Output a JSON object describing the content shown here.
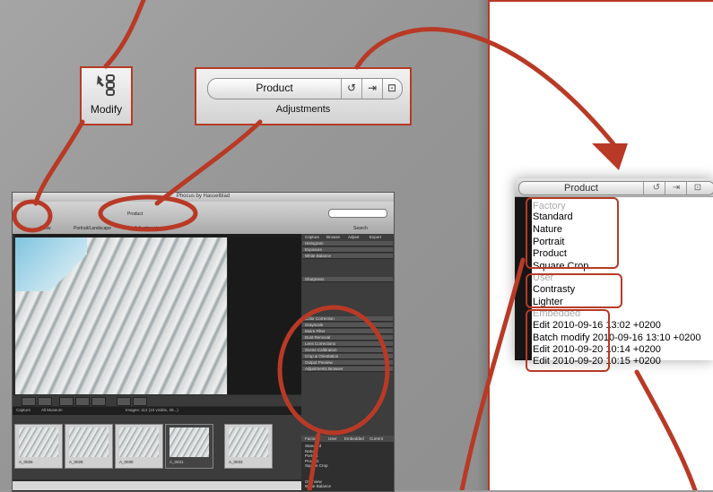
{
  "modify_callout": {
    "label": "Modify",
    "icon": "modify-icon"
  },
  "adjustments_callout": {
    "preset": "Product",
    "label": "Adjustments",
    "buttons": [
      "reset-icon",
      "apply-icon",
      "save-icon"
    ]
  },
  "app": {
    "title": "Phocus by Hasselblad",
    "toolbar": {
      "show_label": "Show",
      "portrait_label": "Portrait/Landscape",
      "preset": "Product",
      "adjustments_label": "Adjustments",
      "search_label": "Search"
    },
    "panel_tabs": [
      "Capture",
      "Browse",
      "Adjust",
      "Export"
    ],
    "panel_sections": [
      "Histogram",
      "Exposure",
      "White Balance",
      "Sharpness",
      "Color Correction",
      "Grayscale",
      "Moire Filter",
      "Dust Removal",
      "Lens Corrections",
      "Scene Calibration",
      "Crop & Orientation",
      "Output Preview",
      "Adjustments Browser"
    ],
    "browser_tabs": [
      "Factory",
      "User",
      "Embedded",
      "Current"
    ],
    "browser_list": [
      "Standard",
      "Nature",
      "Portrait",
      "Product",
      "Square Crop"
    ],
    "browser_bottom": [
      "Overview",
      "White Balance"
    ],
    "browser_bar": {
      "caption": "Capture",
      "folder": "All Museum",
      "count": "Images: 112 (10 visible, 39...)"
    },
    "thumbnails": [
      "A_0026",
      "A_0028",
      "A_0030",
      "A_0031",
      "A_0033"
    ]
  },
  "adjustments_menu": {
    "preset": "Product",
    "factory_header": "Factory",
    "factory_items": [
      "Standard",
      "Nature",
      "Portrait",
      "Product",
      "Square Crop"
    ],
    "user_header": "User",
    "user_items": [
      "Contrasty",
      "Lighter"
    ],
    "embedded_header": "Embedded",
    "embedded_items": [
      "Edit 2010-09-16 13:02 +0200",
      "Batch modify 2010-09-16 13:10 +0200",
      "Edit 2010-09-20 10:14 +0200",
      "Edit 2010-09-20 10:15 +0200"
    ]
  },
  "colors": {
    "callout_red": "#b83a26",
    "background": "#9a9a9a"
  }
}
